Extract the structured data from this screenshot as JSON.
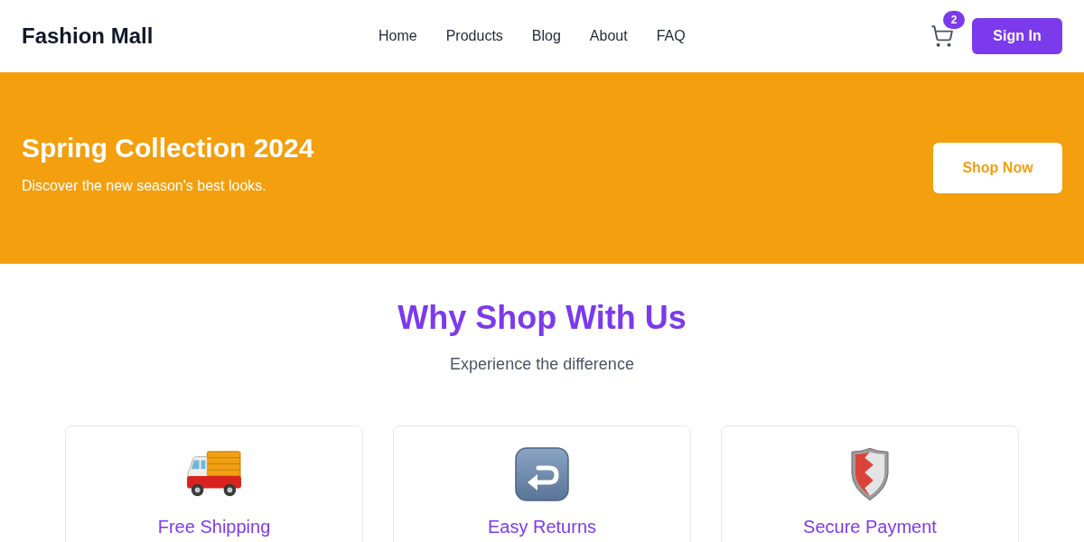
{
  "header": {
    "logo": "Fashion Mall",
    "nav": [
      {
        "label": "Home"
      },
      {
        "label": "Products"
      },
      {
        "label": "Blog"
      },
      {
        "label": "About"
      },
      {
        "label": "FAQ"
      }
    ],
    "cart_count": "2",
    "sign_in": "Sign In"
  },
  "banner": {
    "title": "Spring Collection 2024",
    "subtitle": "Discover the new season's best looks.",
    "button": "Shop Now"
  },
  "features": {
    "title": "Why Shop With Us",
    "subtitle": "Experience the difference",
    "cards": [
      {
        "title": "Free Shipping"
      },
      {
        "title": "Easy Returns"
      },
      {
        "title": "Secure Payment"
      }
    ]
  }
}
